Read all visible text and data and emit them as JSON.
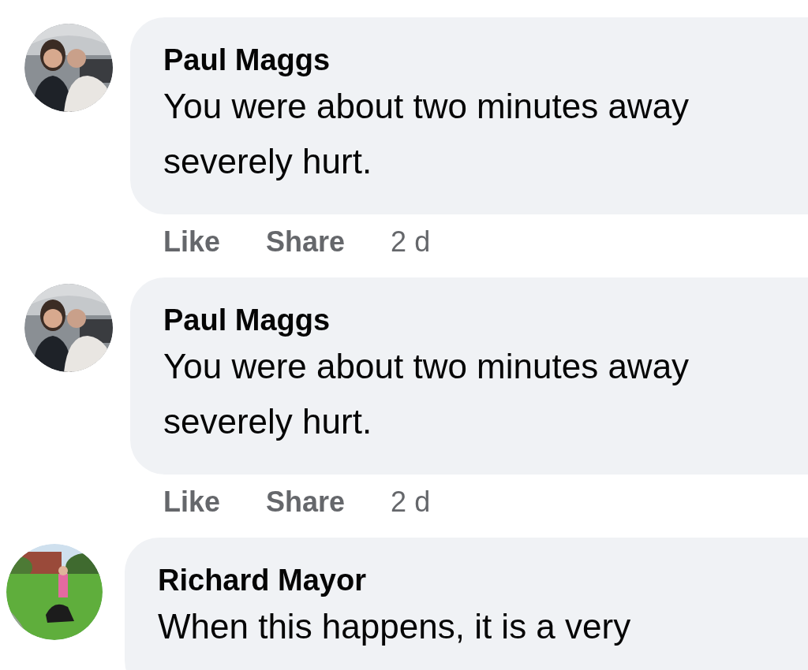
{
  "comments": [
    {
      "author": "Paul Maggs",
      "lines": [
        "You were about two minutes away",
        "severely hurt."
      ],
      "actions": [
        "Like",
        "Share"
      ],
      "time": "2 d"
    },
    {
      "author": "Paul Maggs",
      "lines": [
        "You were about two minutes away",
        "severely hurt."
      ],
      "actions": [
        "Like",
        "Share"
      ],
      "time": "2 d"
    },
    {
      "author": "Richard Mayor",
      "lines": [
        "When this happens, it is a very"
      ]
    }
  ]
}
